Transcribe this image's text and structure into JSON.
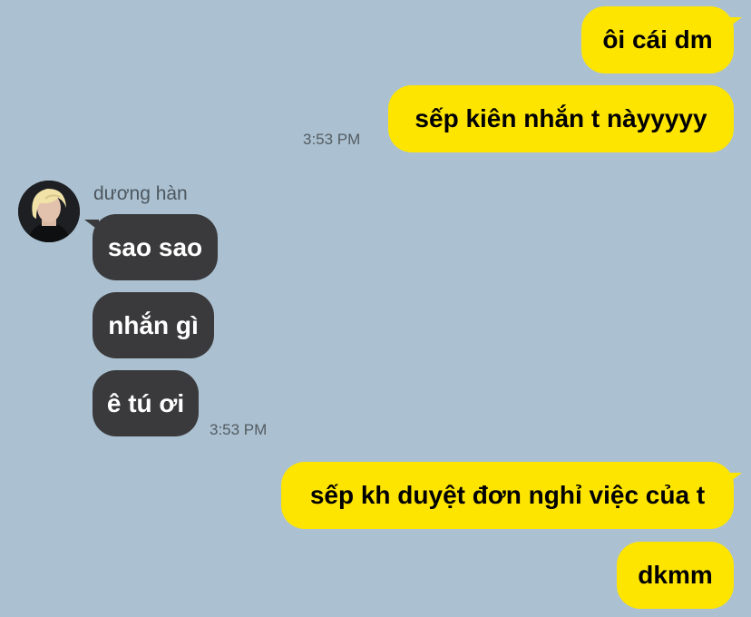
{
  "chat": {
    "background_color": "#abc1d1",
    "my_bubble_color": "#fee500",
    "their_bubble_color": "#3a3a3c",
    "contact": {
      "name": "dương hàn",
      "avatar": "blond-person-avatar"
    },
    "messages": [
      {
        "sender": "me",
        "text": "ôi cái dm"
      },
      {
        "sender": "me",
        "text": "sếp kiên nhắn t nàyyyyy",
        "time": "3:53 PM"
      },
      {
        "sender": "them",
        "text": "sao sao"
      },
      {
        "sender": "them",
        "text": "nhắn gì"
      },
      {
        "sender": "them",
        "text": "ê tú ơi",
        "time": "3:53 PM"
      },
      {
        "sender": "me",
        "text": "sếp kh duyệt đơn nghỉ việc của t"
      },
      {
        "sender": "me",
        "text": "dkmm"
      }
    ]
  }
}
